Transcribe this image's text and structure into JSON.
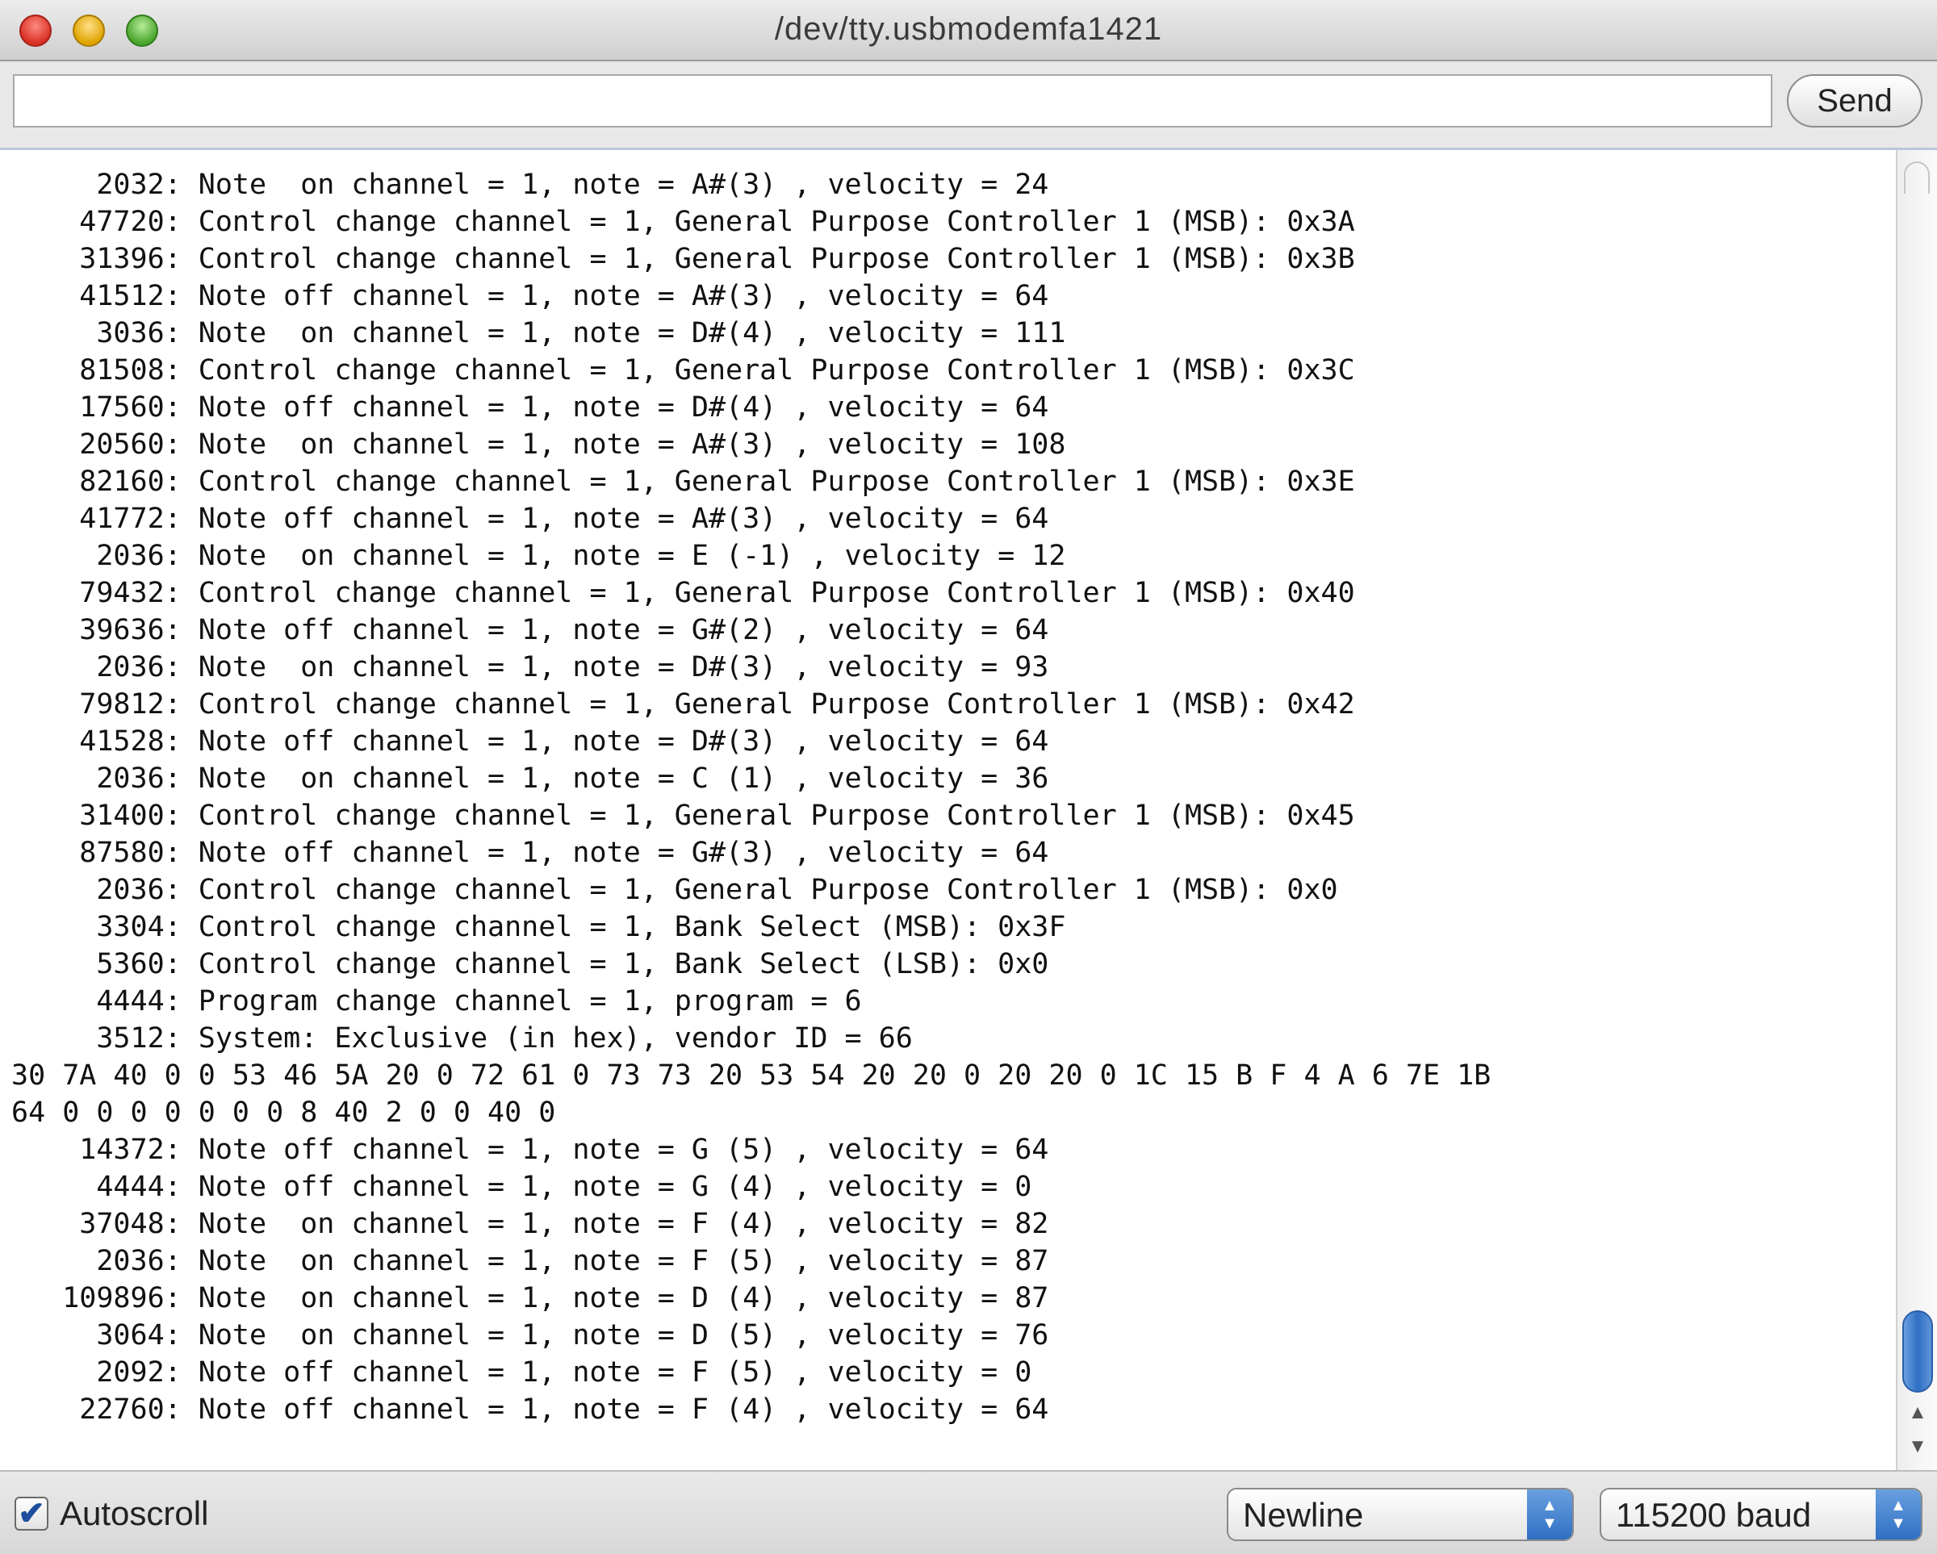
{
  "window": {
    "title": "/dev/tty.usbmodemfa1421"
  },
  "input_row": {
    "input_value": "",
    "send_label": "Send"
  },
  "console": {
    "lines": [
      "     2032: Note  on channel = 1, note = A#(3) , velocity = 24",
      "    47720: Control change channel = 1, General Purpose Controller 1 (MSB): 0x3A",
      "    31396: Control change channel = 1, General Purpose Controller 1 (MSB): 0x3B",
      "    41512: Note off channel = 1, note = A#(3) , velocity = 64",
      "     3036: Note  on channel = 1, note = D#(4) , velocity = 111",
      "    81508: Control change channel = 1, General Purpose Controller 1 (MSB): 0x3C",
      "    17560: Note off channel = 1, note = D#(4) , velocity = 64",
      "    20560: Note  on channel = 1, note = A#(3) , velocity = 108",
      "    82160: Control change channel = 1, General Purpose Controller 1 (MSB): 0x3E",
      "    41772: Note off channel = 1, note = A#(3) , velocity = 64",
      "     2036: Note  on channel = 1, note = E (-1) , velocity = 12",
      "    79432: Control change channel = 1, General Purpose Controller 1 (MSB): 0x40",
      "    39636: Note off channel = 1, note = G#(2) , velocity = 64",
      "     2036: Note  on channel = 1, note = D#(3) , velocity = 93",
      "    79812: Control change channel = 1, General Purpose Controller 1 (MSB): 0x42",
      "    41528: Note off channel = 1, note = D#(3) , velocity = 64",
      "     2036: Note  on channel = 1, note = C (1) , velocity = 36",
      "    31400: Control change channel = 1, General Purpose Controller 1 (MSB): 0x45",
      "    87580: Note off channel = 1, note = G#(3) , velocity = 64",
      "     2036: Control change channel = 1, General Purpose Controller 1 (MSB): 0x0",
      "     3304: Control change channel = 1, Bank Select (MSB): 0x3F",
      "     5360: Control change channel = 1, Bank Select (LSB): 0x0",
      "     4444: Program change channel = 1, program = 6",
      "     3512: System: Exclusive (in hex), vendor ID = 66",
      "30 7A 40 0 0 53 46 5A 20 0 72 61 0 73 73 20 53 54 20 20 0 20 20 0 1C 15 B F 4 A 6 7E 1B",
      "64 0 0 0 0 0 0 0 8 40 2 0 0 40 0",
      "    14372: Note off channel = 1, note = G (5) , velocity = 64",
      "     4444: Note off channel = 1, note = G (4) , velocity = 0",
      "    37048: Note  on channel = 1, note = F (4) , velocity = 82",
      "     2036: Note  on channel = 1, note = F (5) , velocity = 87",
      "   109896: Note  on channel = 1, note = D (4) , velocity = 87",
      "     3064: Note  on channel = 1, note = D (5) , velocity = 76",
      "     2092: Note off channel = 1, note = F (5) , velocity = 0",
      "    22760: Note off channel = 1, note = F (4) , velocity = 64"
    ]
  },
  "bottom_bar": {
    "autoscroll_label": "Autoscroll",
    "autoscroll_checked": true,
    "line_ending_selected": "Newline",
    "baud_selected": "115200 baud"
  },
  "colors": {
    "accent": "#2f6fc4",
    "close": "#d93025",
    "minimize": "#e0a400",
    "zoom": "#49a52c"
  }
}
